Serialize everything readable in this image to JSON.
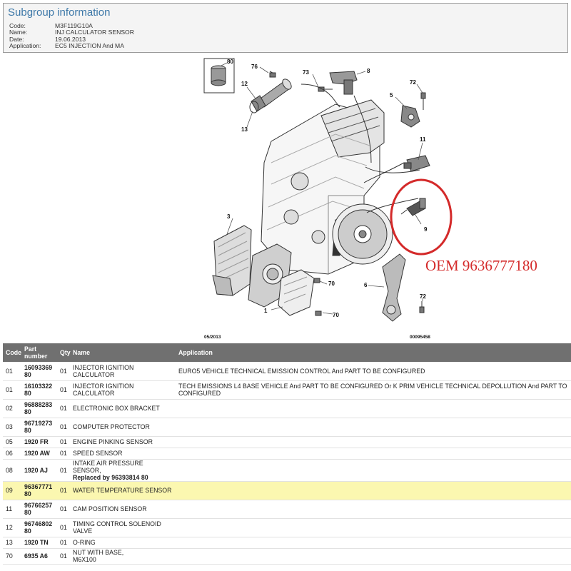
{
  "header": {
    "title": "Subgroup information",
    "fields": [
      {
        "key": "Code:",
        "value": "M3F119G10A"
      },
      {
        "key": "Name:",
        "value": "INJ CALCULATOR SENSOR"
      },
      {
        "key": "Date:",
        "value": "19.06.2013"
      },
      {
        "key": "Application:",
        "value": "EC5 INJECTION And MA"
      }
    ]
  },
  "diagram": {
    "callouts": [
      "80",
      "76",
      "73",
      "8",
      "12",
      "5",
      "72",
      "13",
      "11",
      "3",
      "9",
      "6",
      "70",
      "72",
      "1",
      "70"
    ],
    "date_stamp": "05/2013",
    "drawing_number": "00095458",
    "oem_label": "OEM 9636777180",
    "highlight_color": "#d42a2a"
  },
  "table": {
    "columns": [
      "Code",
      "Part\nnumber",
      "Qty",
      "Name",
      "Application"
    ],
    "highlight_color": "#fbf7b0",
    "rows": [
      {
        "code": "01",
        "part": "16093369\n80",
        "qty": "01",
        "name": "INJECTOR IGNITION\nCALCULATOR",
        "app": "EURO5 VEHICLE TECHNICAL EMISSION CONTROL And PART TO BE CONFIGURED",
        "highlight": false
      },
      {
        "code": "01",
        "part": "16103322\n80",
        "qty": "01",
        "name": "INJECTOR IGNITION\nCALCULATOR",
        "app": "TECH EMISSIONS L4 BASE VEHICLE And PART TO BE CONFIGURED Or K PRIM VEHICLE TECHNICAL DEPOLLUTION And PART TO BE\nCONFIGURED",
        "highlight": false
      },
      {
        "code": "02",
        "part": "96888283\n80",
        "qty": "01",
        "name": "ELECTRONIC BOX BRACKET",
        "app": "",
        "highlight": false
      },
      {
        "code": "03",
        "part": "96719273\n80",
        "qty": "01",
        "name": "COMPUTER PROTECTOR",
        "app": "",
        "highlight": false
      },
      {
        "code": "05",
        "part": "1920 FR",
        "qty": "01",
        "name": "ENGINE PINKING SENSOR",
        "app": "",
        "highlight": false
      },
      {
        "code": "06",
        "part": "1920 AW",
        "qty": "01",
        "name": "SPEED SENSOR",
        "app": "",
        "highlight": false
      },
      {
        "code": "08",
        "part": "1920 AJ",
        "qty": "01",
        "name": "INTAKE AIR PRESSURE SENSOR,",
        "name_extra": "Replaced by 96393814 80",
        "app": "",
        "highlight": false
      },
      {
        "code": "09",
        "part": "96367771\n80",
        "qty": "01",
        "name": "WATER TEMPERATURE SENSOR",
        "app": "",
        "highlight": true
      },
      {
        "code": "11",
        "part": "96766257\n80",
        "qty": "01",
        "name": "CAM POSITION SENSOR",
        "app": "",
        "highlight": false
      },
      {
        "code": "12",
        "part": "96746802\n80",
        "qty": "01",
        "name": "TIMING CONTROL SOLENOID\nVALVE",
        "app": "",
        "highlight": false
      },
      {
        "code": "13",
        "part": "1920 TN",
        "qty": "01",
        "name": "O-RING",
        "app": "",
        "highlight": false
      },
      {
        "code": "70",
        "part": "6935 A6",
        "qty": "01",
        "name": "NUT WITH BASE,\nM6X100",
        "app": "",
        "highlight": false
      }
    ]
  }
}
